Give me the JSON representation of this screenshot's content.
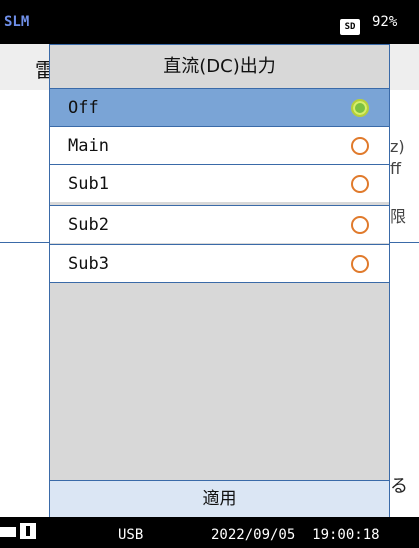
{
  "status": {
    "app_name": "SLM",
    "sd_label": "SD",
    "battery": "92%"
  },
  "background": {
    "title_char": "雷",
    "peek": [
      "z)",
      "ff",
      "限"
    ],
    "apply_peek": "る"
  },
  "dialog": {
    "title": "直流(DC)出力",
    "options": [
      {
        "label": "Off",
        "selected": true
      },
      {
        "label": "Main",
        "selected": false
      },
      {
        "label": "Sub1",
        "selected": false
      },
      {
        "label": "Sub2",
        "selected": false
      },
      {
        "label": "Sub3",
        "selected": false
      }
    ],
    "apply_label": "適用"
  },
  "footer": {
    "usb": "USB",
    "datetime": "2022/09/05  19:00:18"
  },
  "colors": {
    "selected_row": "#7aa4d6",
    "radio_on": "#7cc142",
    "radio_off_border": "#e07a2c",
    "border": "#3a6aa8"
  }
}
